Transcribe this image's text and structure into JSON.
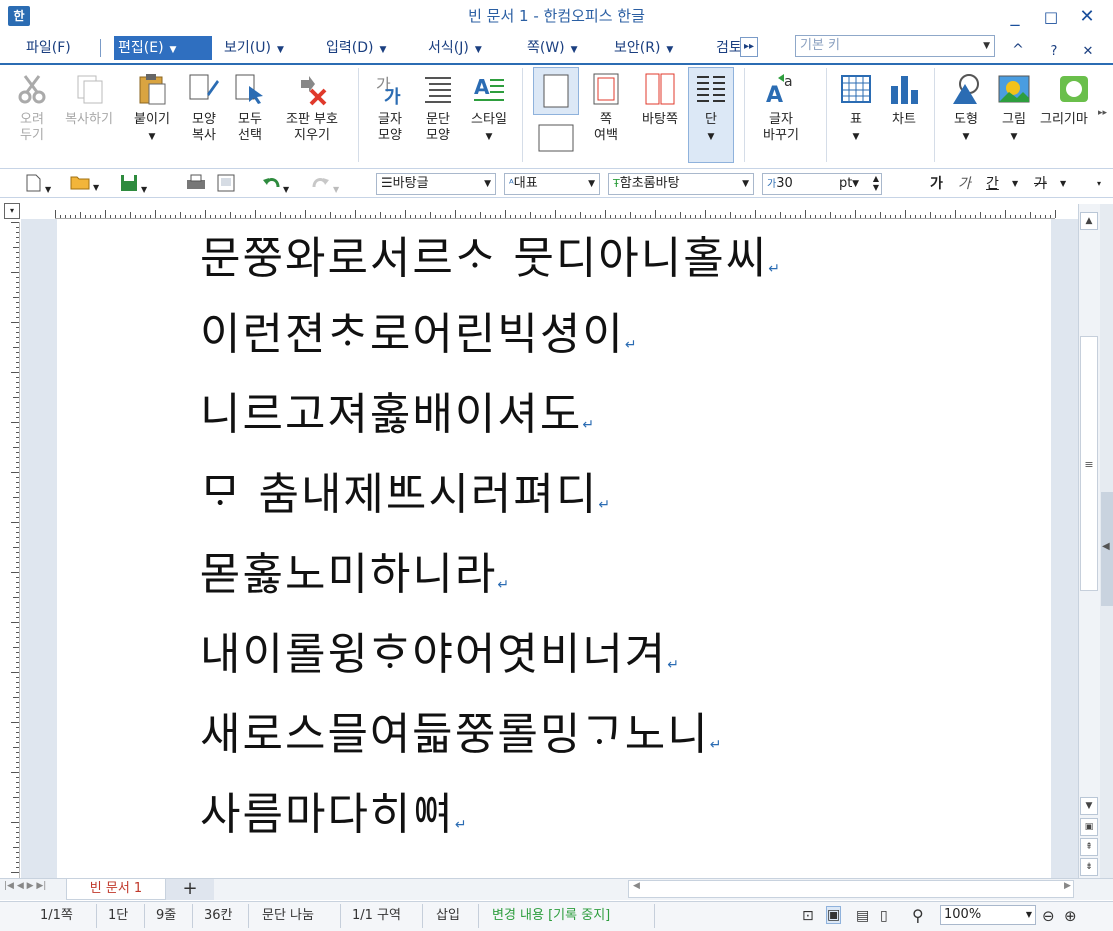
{
  "window": {
    "title": "빈 문서 1 - 한컴오피스 한글",
    "app_icon": "한",
    "minimize": "_",
    "maximize": "□",
    "close": "✕"
  },
  "menu": {
    "items": [
      "파일(F)",
      "편집(E)",
      "보기(U)",
      "입력(D)",
      "서식(J)",
      "쪽(W)",
      "보안(R)",
      "검토"
    ],
    "active": "편집(E)",
    "style_box_value": "기본 키",
    "ribbon_collapse": "^",
    "help": "?",
    "close_doc": "✕"
  },
  "ribbon": {
    "cut": "오려\n두기",
    "copy": "복사하기",
    "paste": "붙이기",
    "format_copy": "모양\n복사",
    "select_all": "모두\n선택",
    "clear_markup": "조판 부호\n지우기",
    "char_shape": "글자\n모양",
    "para_shape": "문단\n모양",
    "style": "스타일",
    "page_margin": "쪽\n여백",
    "master_page": "바탕쪽",
    "columns": "단",
    "change_case": "글자\n바꾸기",
    "table": "표",
    "chart": "차트",
    "shape": "도형",
    "picture": "그림",
    "drawing": "그리기마"
  },
  "toolbar": {
    "style_value": "바탕글",
    "language_value": "대표",
    "font_value": "함초롬바탕",
    "size_value": "30",
    "size_unit": "pt",
    "bold": "가",
    "italic": "가",
    "underline": "간",
    "strike": "가"
  },
  "document": {
    "lines": [
      "문쭝와로서르ᄉᆞ 뭇디아니홀씨",
      "이런젼ᄎᆞ로어린빅셩이",
      "니르고져홇배이셔도",
      "ᄆᆞ 춤내제ᄠᅳ시러펴디",
      "몯홇노미하니라",
      "내이롤윙ᄒᆞ야어엿비너겨",
      "새로스믈여듧쭝롤밍ᄀᆞ노니",
      "사름마다히ᅇᅧ"
    ],
    "paragraph_mark": "↵"
  },
  "tabs": {
    "doc_tab": "빈 문서 1",
    "add": "+"
  },
  "status": {
    "page": "1/1쪽",
    "column": "1단",
    "line": "9줄",
    "col": "36칸",
    "mode": "문단 나눔",
    "section": "1/1 구역",
    "insert": "삽입",
    "track_changes": "변경 내용 [기록 중지]",
    "zoom": "100%"
  },
  "colors": {
    "accent": "#2f6fc0",
    "track_changes": "#2e9e3e",
    "tab_text": "#c0392b"
  }
}
